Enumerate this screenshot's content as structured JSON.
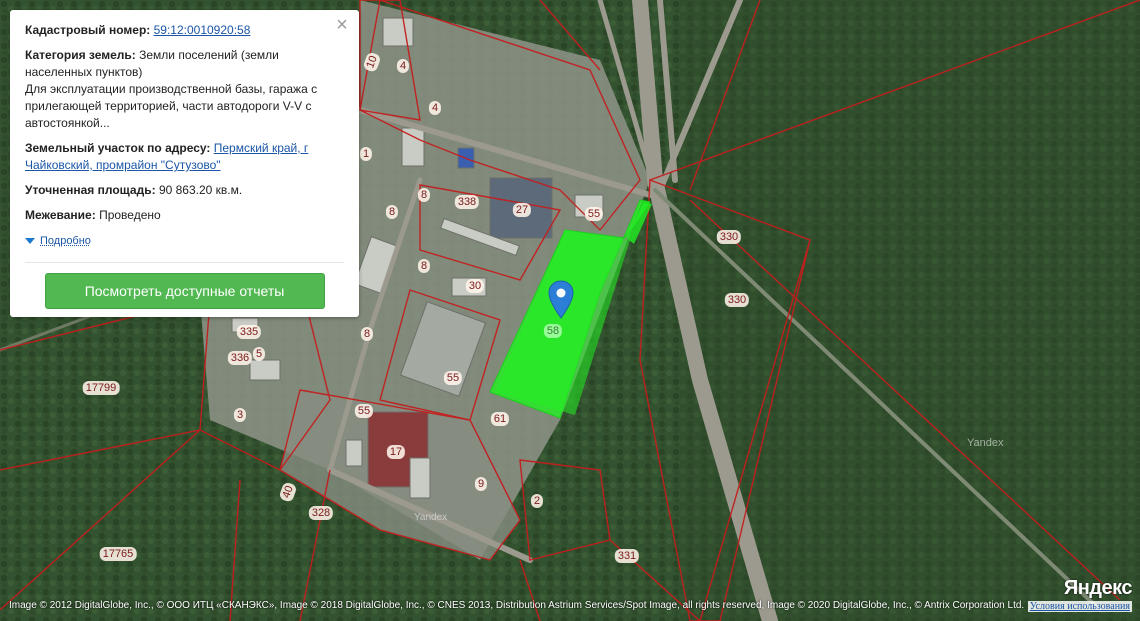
{
  "card": {
    "close_glyph": "×",
    "cadastral_label": "Кадастровый номер:",
    "cadastral_number": "59:12:0010920:58",
    "category_label": "Категория земель:",
    "category_value": "Земли поселений (земли населенных пунктов)",
    "usage_text": "Для эксплуатации производственной базы, гаража с прилегающей территорией, части автодороги V-V с автостоянкой...",
    "address_label": "Земельный участок по адресу:",
    "address_value": "Пермский край, г Чайковский, промрайон \"Сутузово\"",
    "area_label": "Уточненная площадь:",
    "area_value": "90 863.20 кв.м.",
    "survey_label": "Межевание:",
    "survey_value": "Проведено",
    "more_label": "Подробно",
    "reports_button": "Посмотреть доступные отчеты"
  },
  "map": {
    "labels": [
      "10",
      "4",
      "4",
      "1",
      "8",
      "338",
      "27",
      "55",
      "330",
      "330",
      "8",
      "8",
      "30",
      "58",
      "335",
      "5",
      "336",
      "8",
      "3",
      "55",
      "55",
      "17799",
      "61",
      "17",
      "9",
      "2",
      "40",
      "328",
      "17765",
      "331"
    ],
    "selected_parcel_label": "58",
    "selected_color": "#22f022",
    "boundary_color": "#c41e1e",
    "watermark": "Yandex",
    "watermark_small": "Yandex"
  },
  "footer": {
    "attribution": "Image © 2012 DigitalGlobe, Inc., © ООО ИТЦ «СКАНЭКС», Image © 2018 DigitalGlobe, Inc., © CNES 2013, Distribution Astrium Services/Spot Image, all rights reserved, Image © 2020 DigitalGlobe, Inc., © Antrix Corporation Ltd.",
    "terms": "Условия использования",
    "logo": "Яндекс"
  }
}
